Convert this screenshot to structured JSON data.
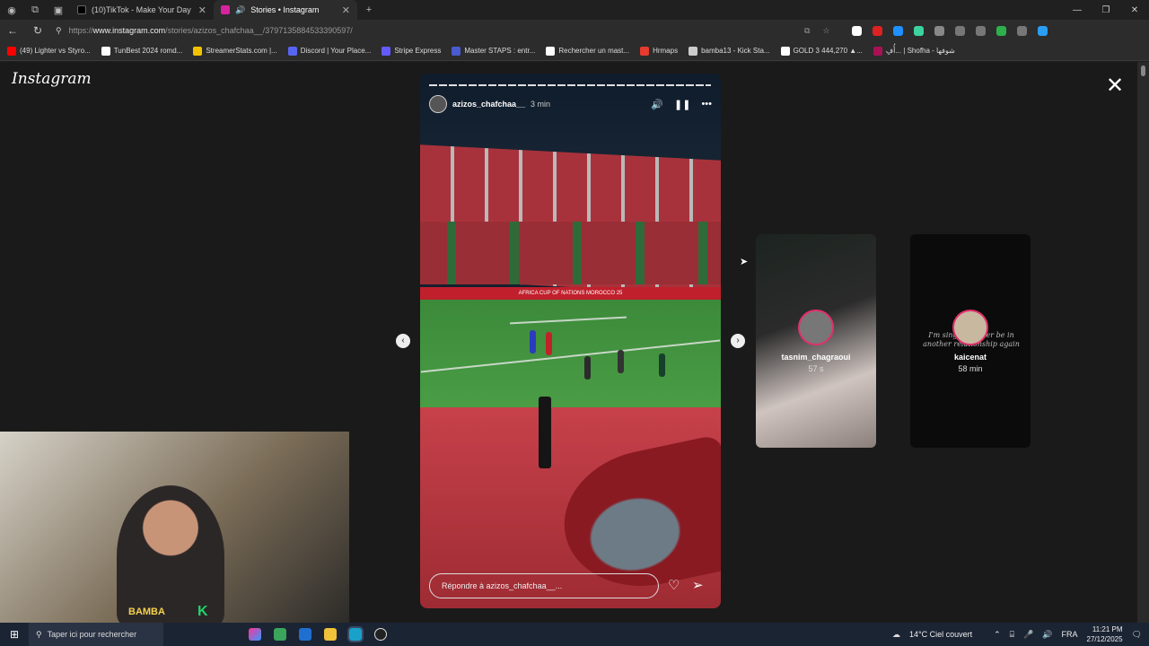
{
  "browser": {
    "tabs": [
      {
        "label": "(10)TikTok - Make Your Day",
        "favicon_color": "#111111"
      },
      {
        "label": "Stories • Instagram",
        "favicon_color": "#d6249f"
      }
    ],
    "url_host": "www.instagram.com",
    "url_prefix": "https://",
    "url_path": "/stories/azizos_chafchaa__/3797135884533390597/",
    "bookmarks": [
      {
        "label": "(49) Lighter vs Styro...",
        "color": "#ff0000"
      },
      {
        "label": "TunBest 2024 romd...",
        "color": "#ffffff"
      },
      {
        "label": "StreamerStats.com |...",
        "color": "#f2c200"
      },
      {
        "label": "Discord | Your Place...",
        "color": "#5865f2"
      },
      {
        "label": "Stripe Express",
        "color": "#635bff"
      },
      {
        "label": "Master STAPS : entr...",
        "color": "#4a5ad0"
      },
      {
        "label": "Rechercher un mast...",
        "color": "#ffffff"
      },
      {
        "label": "Hrmaps",
        "color": "#e63b2e"
      },
      {
        "label": "bamba13 - Kick Sta...",
        "color": "#cccccc"
      },
      {
        "label": "GOLD 3 444,270 ▲...",
        "color": "#ffffff"
      },
      {
        "label": "أُفِ... | Shofha - شوفها",
        "color": "#aa1155"
      }
    ]
  },
  "instagram": {
    "logo": "Instagram",
    "story": {
      "username": "azizos_chafchaa__",
      "time": "3 min",
      "adboard": "AFRICA CUP OF NATIONS MOROCCO 25",
      "reply_placeholder": "Répondre à azizos_chafchaa__..."
    },
    "next_stories": [
      {
        "username": "tasnim_chagraoui",
        "time": "57 s"
      },
      {
        "username": "kaicenat",
        "time": "58 min",
        "quote": "I'm single... never be in another relationship again"
      }
    ]
  },
  "webcam": {
    "overlay_text": "BAMBA",
    "overlay_k": "K"
  },
  "taskbar": {
    "search_placeholder": "Taper ici pour rechercher",
    "weather": "14°C  Ciel couvert",
    "language": "FRA",
    "time": "11:21 PM",
    "date": "27/12/2025"
  }
}
